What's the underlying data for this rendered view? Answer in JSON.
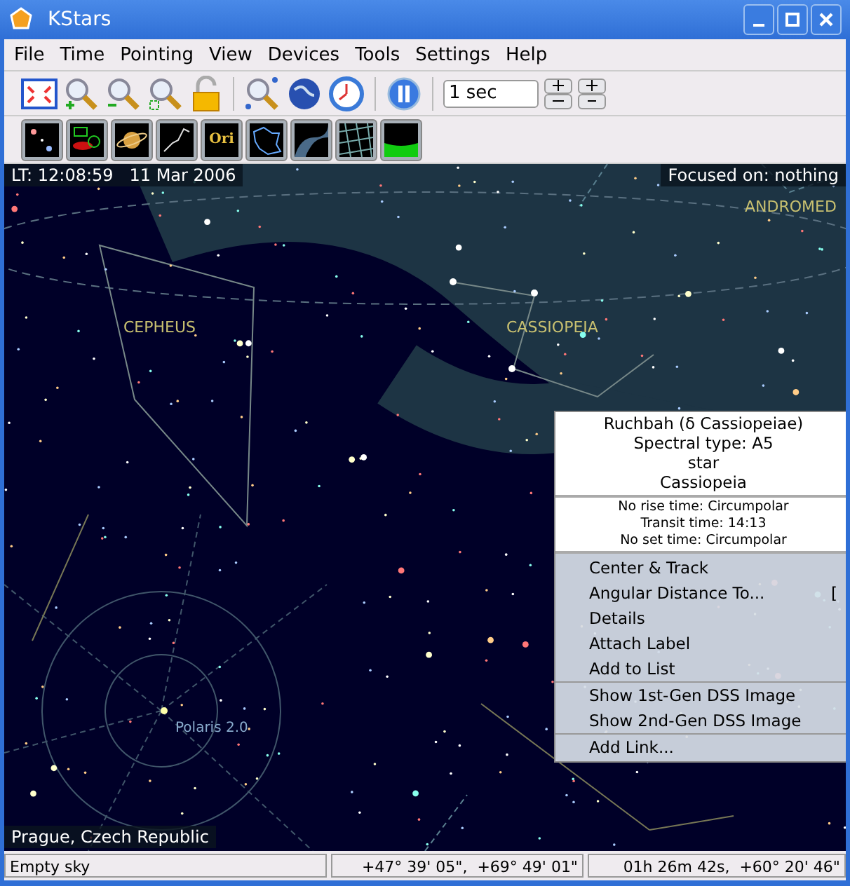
{
  "window": {
    "title": "KStars"
  },
  "menu": [
    "File",
    "Time",
    "Pointing",
    "View",
    "Devices",
    "Tools",
    "Settings",
    "Help"
  ],
  "toolbar": {
    "time_step": "1 sec"
  },
  "view_toolbar": [
    {
      "kind": "stars",
      "on": true
    },
    {
      "kind": "deepsky",
      "on": true
    },
    {
      "kind": "planet",
      "on": true
    },
    {
      "kind": "lines",
      "on": true
    },
    {
      "kind": "names",
      "on": true,
      "label": "Ori"
    },
    {
      "kind": "bounds",
      "on": true
    },
    {
      "kind": "milkyway",
      "on": true
    },
    {
      "kind": "grid",
      "on": true
    },
    {
      "kind": "horizon",
      "on": true
    }
  ],
  "sky": {
    "time": "LT: 12:08:59   11 Mar 2006",
    "focus": "Focused on: nothing",
    "location": "Prague, Czech Republic",
    "labels": [
      {
        "text": "CEPHEUS",
        "kind": "constellation"
      },
      {
        "text": "CASSIOPEIA",
        "kind": "constellation"
      },
      {
        "text": "ANDROMED",
        "kind": "constellation"
      },
      {
        "text": "Polaris 2.0",
        "kind": "star"
      }
    ]
  },
  "popup": {
    "header": [
      "Ruchbah (δ Cassiopeiae)",
      "Spectral type: A5",
      "star",
      "Cassiopeia"
    ],
    "times": [
      "No rise time: Circumpolar",
      "Transit time: 14:13",
      "No set time: Circumpolar"
    ],
    "items": [
      {
        "kind": "item",
        "label": "Center & Track"
      },
      {
        "kind": "item",
        "label": "Angular Distance To...",
        "shortcut": "["
      },
      {
        "kind": "item",
        "label": "Details"
      },
      {
        "kind": "item",
        "label": "Attach Label"
      },
      {
        "kind": "item",
        "label": "Add to List"
      },
      {
        "kind": "separator"
      },
      {
        "kind": "item",
        "label": "Show 1st-Gen DSS Image"
      },
      {
        "kind": "item",
        "label": "Show 2nd-Gen DSS Image"
      },
      {
        "kind": "separator"
      },
      {
        "kind": "item",
        "label": "Add Link..."
      }
    ]
  },
  "status_bar": [
    "Empty sky",
    "+47° 39' 05\",  +69° 49' 01\"",
    "01h 26m 42s,  +60° 20' 46\""
  ]
}
